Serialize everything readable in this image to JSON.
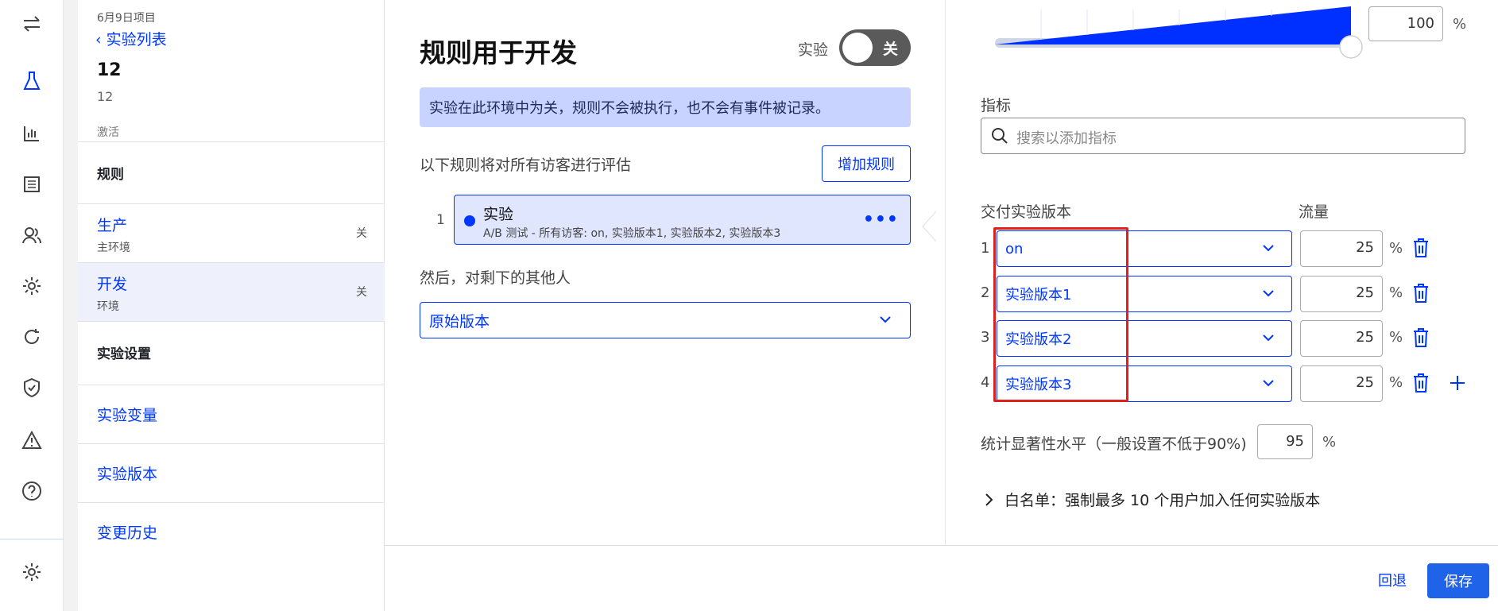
{
  "rail": {
    "icons": [
      "swap-icon",
      "flask-icon",
      "bar-chart-icon",
      "list-icon",
      "users-icon",
      "gear-icon",
      "refresh-icon",
      "shield-check-icon",
      "warning-icon",
      "help-icon",
      "settings-icon"
    ]
  },
  "nav": {
    "project": "6月9日项目",
    "back_label": "实验列表",
    "experiment_name": "12",
    "experiment_key": "12",
    "status": "激活",
    "rules_header": "规则",
    "environments": [
      {
        "name": "生产",
        "sub": "主环境",
        "state": "关"
      },
      {
        "name": "开发",
        "sub": "环境",
        "state": "关"
      }
    ],
    "settings_header": "实验设置",
    "links": [
      "实验变量",
      "实验版本",
      "变更历史"
    ]
  },
  "main": {
    "title": "规则用于开发",
    "toggle_label": "实验",
    "toggle_state": "关",
    "banner": "实验在此环境中为关，规则不会被执行，也不会有事件被记录。",
    "eval_desc": "以下规则将对所有访客进行评估",
    "add_rule": "增加规则",
    "rule": {
      "index": "1",
      "title": "实验",
      "subtitle": "A/B 测试 - 所有访客: on, 实验版本1, 实验版本2, 实验版本3",
      "more": "•••"
    },
    "then_label": "然后，对剩下的其他人",
    "fallback_value": "原始版本"
  },
  "right": {
    "traffic_value": "100",
    "pct": "%",
    "metrics_label": "指标",
    "search_placeholder": "搜索以添加指标",
    "variations_label": "交付实验版本",
    "traffic_label": "流量",
    "variations": [
      {
        "idx": "1",
        "name": "on",
        "traffic": "25"
      },
      {
        "idx": "2",
        "name": "实验版本1",
        "traffic": "25"
      },
      {
        "idx": "3",
        "name": "实验版本2",
        "traffic": "25"
      },
      {
        "idx": "4",
        "name": "实验版本3",
        "traffic": "25"
      }
    ],
    "significance_label": "统计显著性水平（一般设置不低于90%)",
    "significance_value": "95",
    "whitelist": "白名单：强制最多 10 个用户加入任何实验版本"
  },
  "footer": {
    "revert": "回退",
    "save": "保存"
  },
  "colors": {
    "accent": "#0037ff",
    "primary_button": "#1f63e8",
    "banner_bg": "#c9d3ff",
    "highlight": "#e0201c"
  }
}
